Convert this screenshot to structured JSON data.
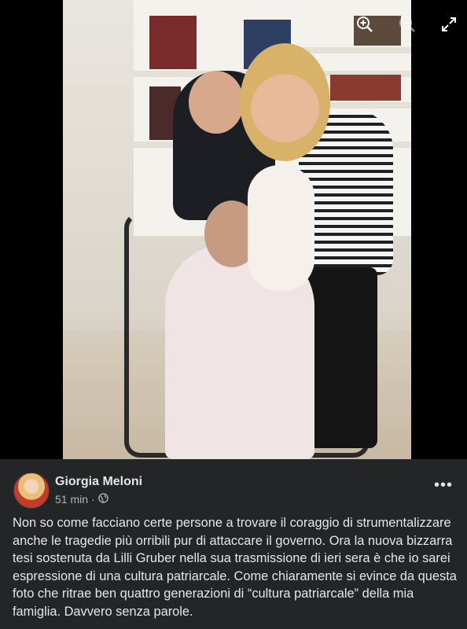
{
  "viewer": {
    "zoom_in_icon": "zoom-in-icon",
    "zoom_out_icon": "zoom-out-icon",
    "fullscreen_icon": "fullscreen-icon"
  },
  "post": {
    "author": "Giorgia Meloni",
    "time": "51 min",
    "separator": "·",
    "audience_icon": "globe-icon",
    "more_label": "•••",
    "text": "Non so come facciano certe persone a trovare il coraggio di strumentalizzare anche le tragedie più orribili pur di attaccare il governo. Ora la nuova bizzarra tesi sostenuta da Lilli Gruber nella sua trasmissione di ieri sera è che io sarei espressione di una cultura patriarcale. Come chiaramente si evince da questa foto che ritrae ben quattro generazioni di “cultura patriarcale” della mia famiglia. Davvero senza parole."
  },
  "colors": {
    "post_bg": "#242526",
    "text_primary": "#e4e6eb",
    "text_secondary": "#b0b3b8",
    "viewer_bg": "#000000"
  }
}
